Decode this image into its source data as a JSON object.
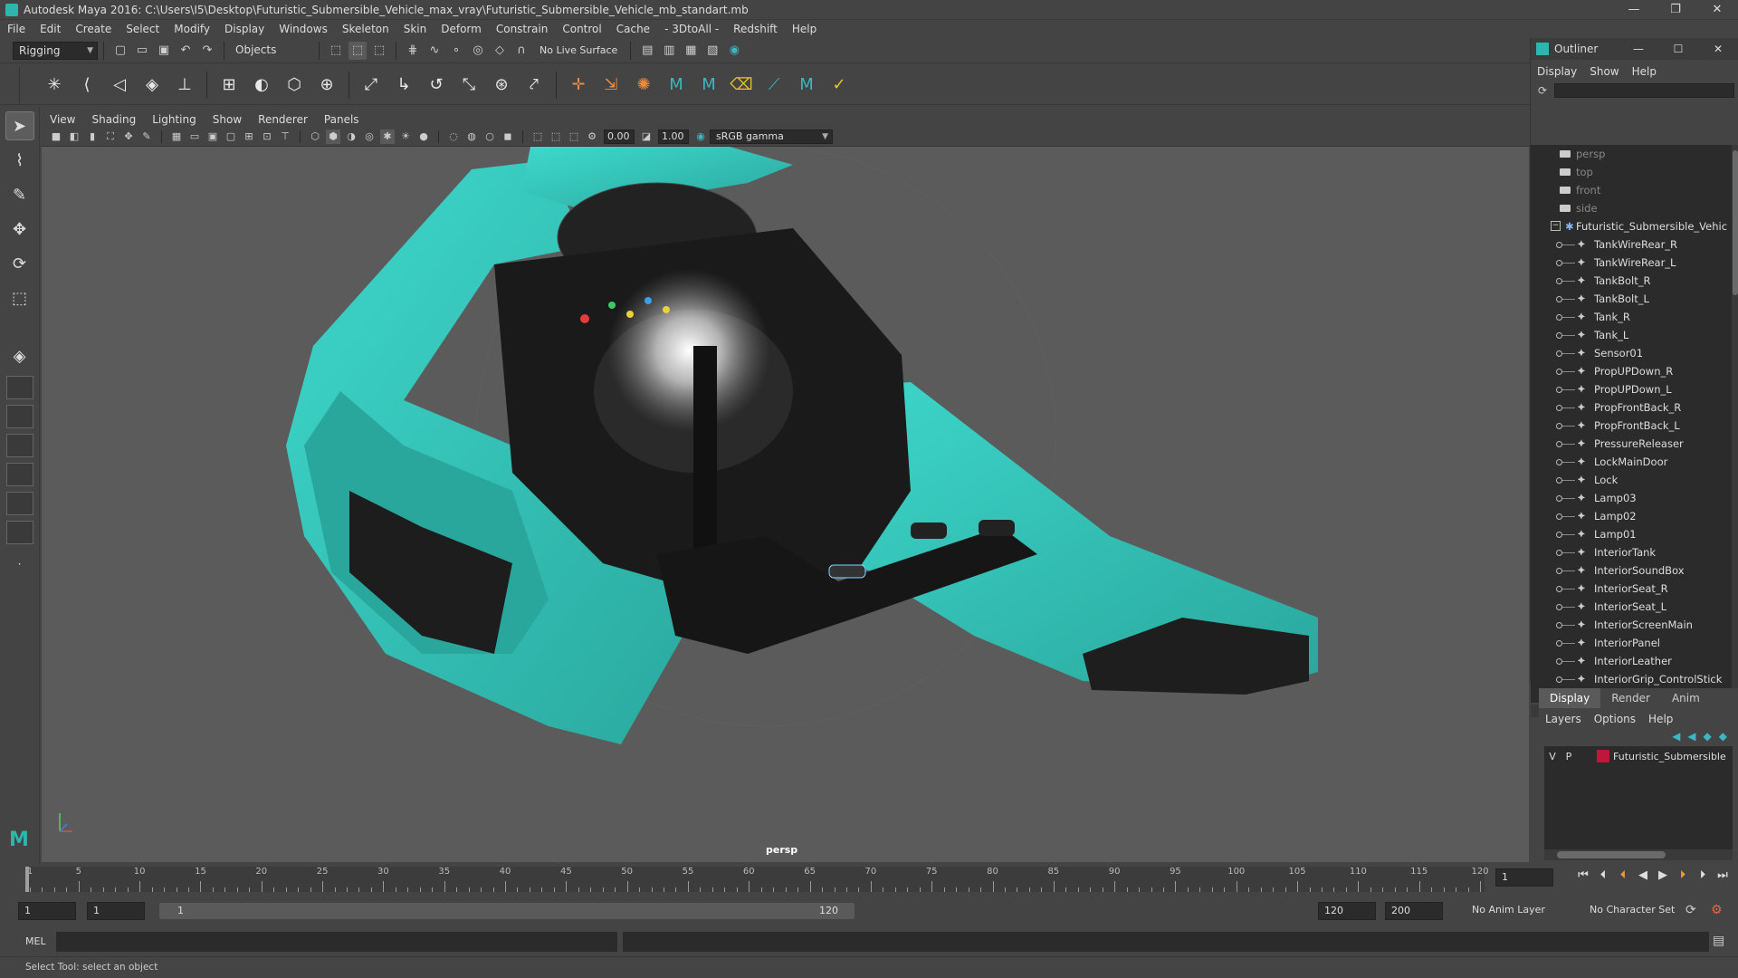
{
  "window": {
    "title": "Autodesk Maya 2016: C:\\Users\\I5\\Desktop\\Futuristic_Submersible_Vehicle_max_vray\\Futuristic_Submersible_Vehicle_mb_standart.mb",
    "controls": [
      "—",
      "❐",
      "✕"
    ]
  },
  "menus": [
    "File",
    "Edit",
    "Create",
    "Select",
    "Modify",
    "Display",
    "Windows",
    "Skeleton",
    "Skin",
    "Deform",
    "Constrain",
    "Control",
    "Cache",
    "- 3DtoAll -",
    "Redshift",
    "Help"
  ],
  "statusline": {
    "mode": "Rigging",
    "selection_mask": "Objects",
    "live_surface": "No Live Surface"
  },
  "panel": {
    "menus": [
      "View",
      "Shading",
      "Lighting",
      "Show",
      "Renderer",
      "Panels"
    ],
    "exposure": "0.00",
    "gamma": "1.00",
    "color_space": "sRGB gamma",
    "camera": "persp"
  },
  "outliner": {
    "title": "Outliner",
    "controls": [
      "—",
      "☐",
      "✕"
    ],
    "menus": [
      "Display",
      "Show",
      "Help"
    ],
    "cameras": [
      "persp",
      "top",
      "front",
      "side"
    ],
    "root": "Futuristic_Submersible_Vehic",
    "items": [
      "TankWireRear_R",
      "TankWireRear_L",
      "TankBolt_R",
      "TankBolt_L",
      "Tank_R",
      "Tank_L",
      "Sensor01",
      "PropUPDown_R",
      "PropUPDown_L",
      "PropFrontBack_R",
      "PropFrontBack_L",
      "PressureReleaser",
      "LockMainDoor",
      "Lock",
      "Lamp03",
      "Lamp02",
      "Lamp01",
      "InteriorTank",
      "InteriorSoundBox",
      "InteriorSeat_R",
      "InteriorSeat_L",
      "InteriorScreenMain",
      "InteriorPanel",
      "InteriorLeather",
      "InteriorGrip_ControlStick",
      "InteriorGrip_ControlStick"
    ]
  },
  "layers": {
    "tabs": [
      "Display",
      "Render",
      "Anim"
    ],
    "active_tab": "Display",
    "menus": [
      "Layers",
      "Options",
      "Help"
    ],
    "rows": [
      {
        "v": "V",
        "p": "P",
        "name": "Futuristic_Submersible",
        "color": "#c0163c"
      }
    ]
  },
  "timeline": {
    "ticks": [
      1,
      5,
      10,
      15,
      20,
      25,
      30,
      35,
      40,
      45,
      50,
      55,
      60,
      65,
      70,
      75,
      80,
      85,
      90,
      95,
      100,
      105,
      110,
      115,
      120
    ],
    "current_frame": "1",
    "min": 1,
    "max": 120
  },
  "range": {
    "start": "1",
    "current": "1",
    "range_start": "1",
    "range_end": "120",
    "end": "120",
    "anim_end": "200",
    "anim_layer": "No Anim Layer",
    "character_set": "No Character Set"
  },
  "cmdline": {
    "label": "MEL"
  },
  "helpline": {
    "text": "Select Tool: select an object"
  },
  "colors": {
    "teal": "#35c4b8",
    "layer_red": "#c0163c",
    "viewport_bg": "#5b5b5b"
  }
}
